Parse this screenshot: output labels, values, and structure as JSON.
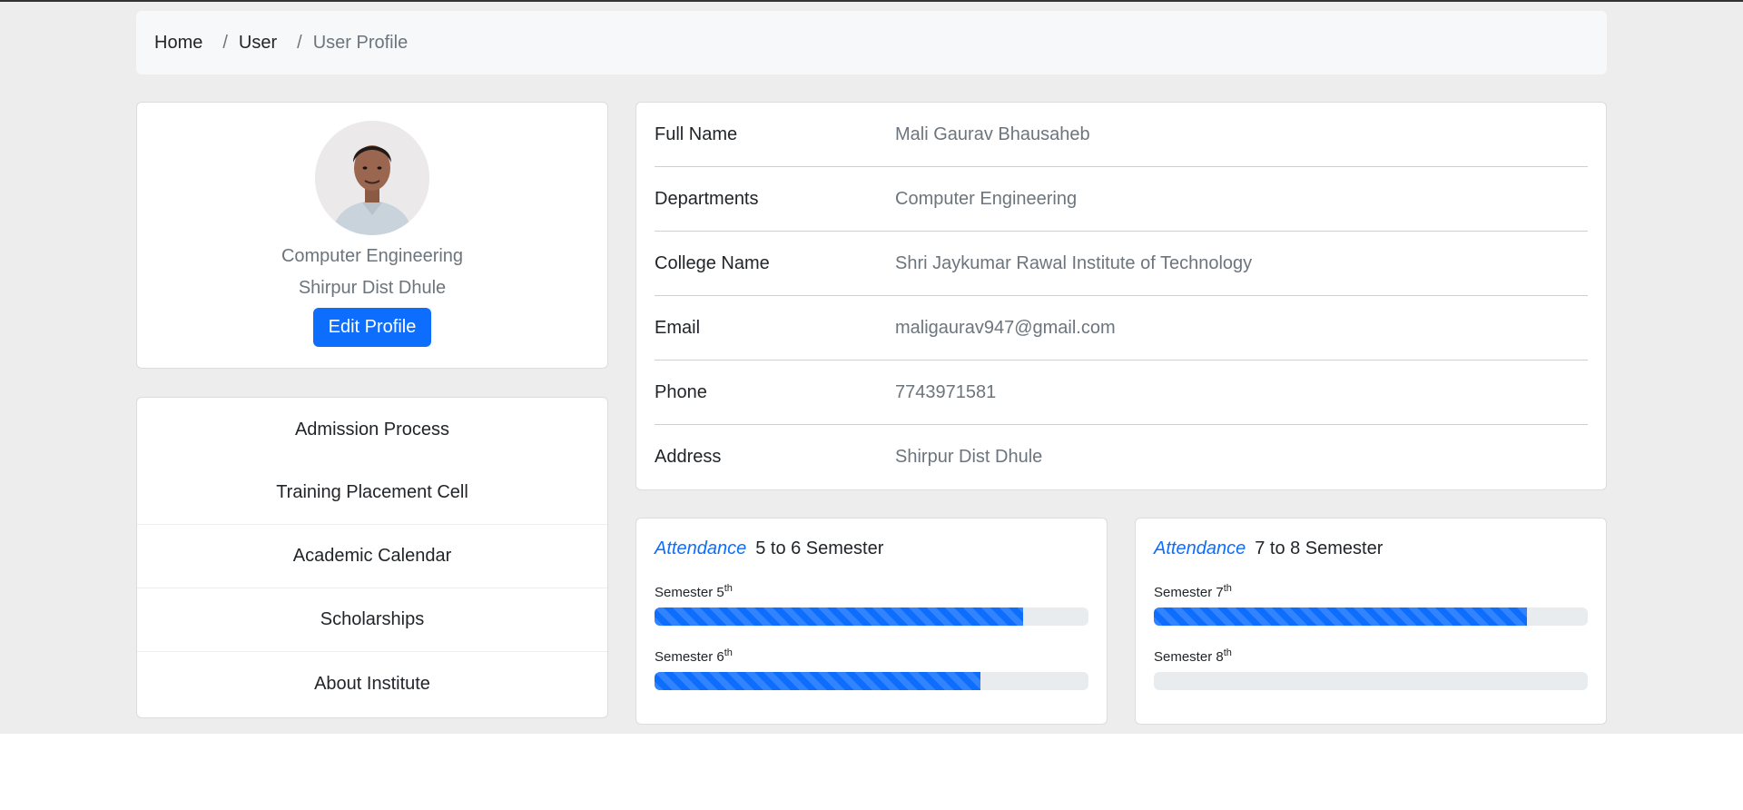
{
  "breadcrumb": {
    "items": [
      {
        "label": "Home"
      },
      {
        "label": "User"
      }
    ],
    "separator": "/",
    "active": "User Profile"
  },
  "profile": {
    "department": "Computer Engineering",
    "location": "Shirpur Dist Dhule",
    "edit_button": "Edit Profile"
  },
  "menu": {
    "items": [
      {
        "label": "Admission Process"
      },
      {
        "label": "Training Placement Cell"
      },
      {
        "label": "Academic Calendar"
      },
      {
        "label": "Scholarships"
      },
      {
        "label": "About Institute"
      }
    ]
  },
  "details": {
    "rows": [
      {
        "label": "Full Name",
        "value": "Mali Gaurav Bhausaheb"
      },
      {
        "label": "Departments",
        "value": "Computer Engineering"
      },
      {
        "label": "College Name",
        "value": "Shri Jaykumar Rawal Institute of Technology"
      },
      {
        "label": "Email",
        "value": "maligaurav947@gmail.com"
      },
      {
        "label": "Phone",
        "value": "7743971581"
      },
      {
        "label": "Address",
        "value": "Shirpur Dist Dhule"
      }
    ]
  },
  "attendance": [
    {
      "accent": "Attendance",
      "title": "5 to 6 Semester",
      "semesters": [
        {
          "label": "Semester 5",
          "suffix": "th",
          "progress_percent": 85
        },
        {
          "label": "Semester 6",
          "suffix": "th",
          "progress_percent": 75
        }
      ]
    },
    {
      "accent": "Attendance",
      "title": "7 to 8 Semester",
      "semesters": [
        {
          "label": "Semester 7",
          "suffix": "th",
          "progress_percent": 86
        },
        {
          "label": "Semester 8",
          "suffix": "th",
          "progress_percent": 0
        }
      ]
    }
  ],
  "colors": {
    "primary": "#0d6efd",
    "page_background": "#ededed",
    "muted_text": "#6c757d"
  }
}
